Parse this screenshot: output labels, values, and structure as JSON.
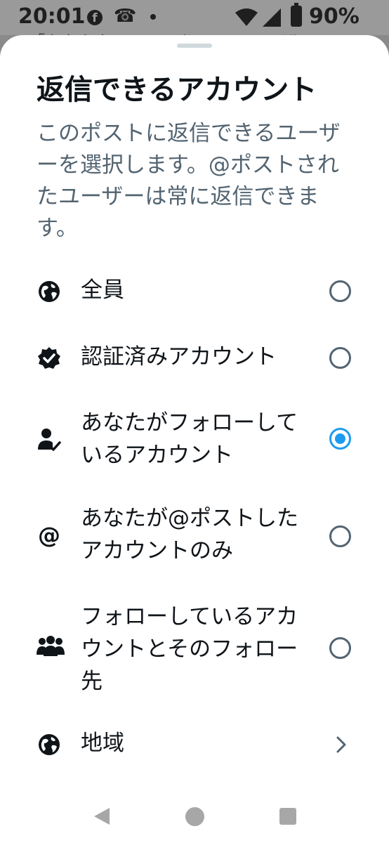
{
  "status_bar": {
    "time": "20:01",
    "facebook_glyph": "f",
    "notification_glyph": "☎",
    "battery": "90%"
  },
  "background": {
    "partial_text": "「あなたをフォローしているユーザー」"
  },
  "sheet": {
    "title": "返信できるアカウント",
    "description": "このポストに返信できるユーザーを選択します。@ポストされたユーザーは常に返信できます。",
    "options": [
      {
        "label": "全員",
        "icon": "globe-icon",
        "selected": false
      },
      {
        "label": "認証済みアカウント",
        "icon": "verified-badge-icon",
        "selected": false
      },
      {
        "label": "あなたがフォローしているアカウント",
        "icon": "person-check-icon",
        "selected": true
      },
      {
        "label": "あなたが@ポストしたアカウントのみ",
        "icon": "at-sign-icon",
        "selected": false
      },
      {
        "label": "フォローしているアカウントとそのフォロー先",
        "icon": "group-icon",
        "selected": false
      },
      {
        "label": "地域",
        "icon": "globe-icon",
        "type": "navigation"
      }
    ]
  },
  "colors": {
    "accent": "#1d9bf0",
    "text_primary": "#0f1419",
    "text_secondary": "#536471"
  }
}
